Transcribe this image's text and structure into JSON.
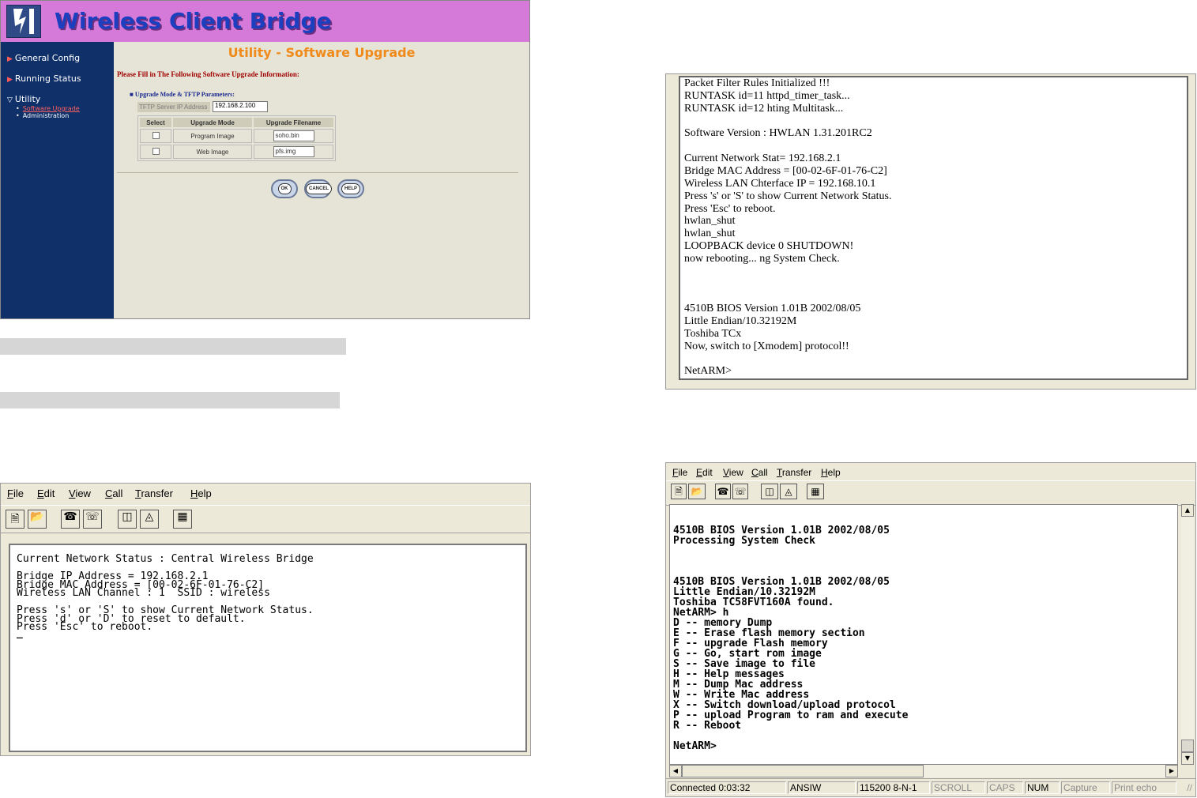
{
  "router": {
    "title": "Wireless Client Bridge",
    "nav": [
      {
        "label": "General Config"
      },
      {
        "label": "Running Status"
      },
      {
        "label": "Utility"
      }
    ],
    "subnav": [
      {
        "label": "Software Upgrade"
      },
      {
        "label": "Administration"
      }
    ],
    "page_heading": "Utility - Software Upgrade",
    "intro": "Please Fill in The Following Software Upgrade Information:",
    "section_label": "Upgrade Mode & TFTP Parameters:",
    "tftp_label": "TFTP Server IP Address",
    "tftp_value": "192.168.2.100",
    "table_headers": [
      "Select",
      "Upgrade Mode",
      "Upgrade Filename"
    ],
    "rows": [
      {
        "mode": "Program Image",
        "filename": "soho.bin"
      },
      {
        "mode": "Web Image",
        "filename": "pfs.img"
      }
    ],
    "buttons": {
      "ok": "OK",
      "cancel": "CANCEL",
      "help": "HELP"
    },
    "colors": {
      "banner": "#d57ad8",
      "sidebar": "#10306a",
      "heading": "#f08a1a",
      "intro": "#a00000"
    }
  },
  "menu": [
    "File",
    "Edit",
    "View",
    "Call",
    "Transfer",
    "Help"
  ],
  "toolbar_icons": [
    "new-icon",
    "open-icon",
    "call-icon",
    "disconnect-icon",
    "send-icon",
    "receive-icon",
    "properties-icon"
  ],
  "terminal_left": {
    "lines": [
      "Current Network Status : Central Wireless Bridge",
      "",
      "Bridge IP Address = 192.168.2.1",
      "Bridge MAC Address = [00-02-6F-01-76-C2]",
      "Wireless LAN Channel : 1  SSID : wireless",
      "",
      "Press 's' or 'S' to show Current Network Status.",
      "Press 'd' or 'D' to reset to default.",
      "Press 'Esc' to reboot.",
      "_"
    ]
  },
  "console_right": {
    "lines": [
      "Packet Filter Rules Initialized !!!",
      "RUNTASK id=11 httpd_timer_task...",
      "RUNTASK id=12 hting Multitask...",
      "",
      "Software Version : HWLAN 1.31.201RC2",
      "",
      "Current Network Stat= 192.168.2.1",
      "Bridge MAC Address = [00-02-6F-01-76-C2]",
      "Wireless LAN Chterface IP = 192.168.10.1",
      "Press 's' or 'S' to show Current Network Status.",
      "Press 'Esc' to reboot.",
      "hwlan_shut",
      "hwlan_shut",
      "LOOPBACK device 0 SHUTDOWN!",
      "now rebooting... ng System Check.",
      "",
      "",
      "",
      "4510B BIOS Version 1.01B 2002/08/05",
      "Little Endian/10.32192M",
      "Toshiba TCx",
      "Now, switch to [Xmodem] protocol!!",
      "",
      "NetARM>"
    ]
  },
  "hyperterminal": {
    "lines": [
      "4510B BIOS Version 1.01B 2002/08/05",
      "Processing System Check",
      "",
      "",
      "",
      "4510B BIOS Version 1.01B 2002/08/05",
      "Little Endian/10.32192M",
      "Toshiba TC58FVT160A found.",
      "NetARM> h",
      "D -- memory Dump",
      "E -- Erase flash memory section",
      "F -- upgrade Flash memory",
      "G -- Go, start rom image",
      "S -- Save image to file",
      "H -- Help messages",
      "M -- Dump Mac address",
      "W -- Write Mac address",
      "X -- Switch download/upload protocol",
      "P -- upload Program to ram and execute",
      "R -- Reboot",
      "",
      "NetARM>"
    ],
    "status": [
      "Connected 0:03:32",
      "ANSIW",
      "115200 8-N-1",
      "SCROLL",
      "CAPS",
      "NUM",
      "Capture",
      "Print echo"
    ]
  }
}
